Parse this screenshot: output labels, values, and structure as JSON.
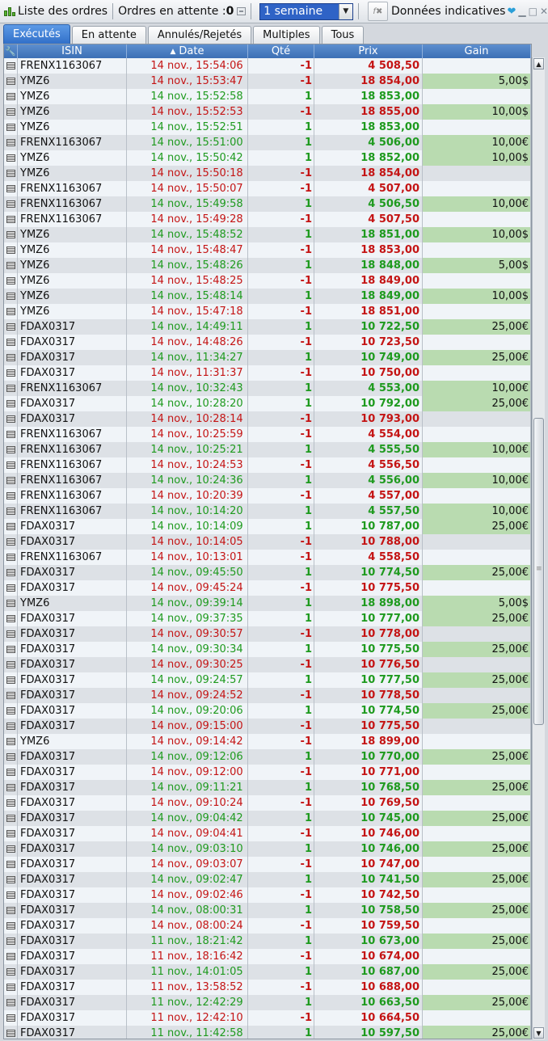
{
  "toolbar": {
    "title": "Liste des ordres",
    "pending_label": "Ordres en attente :",
    "pending_count": "0",
    "period_value": "1 semaine",
    "filter_icon": "f",
    "indicative_label": "Données indicatives"
  },
  "tabs": [
    "Exécutés",
    "En attente",
    "Annulés/Rejetés",
    "Multiples",
    "Tous"
  ],
  "columns": {
    "isin": "ISIN",
    "date": "Date",
    "qty": "Qté",
    "prix": "Prix",
    "gain": "Gain"
  },
  "colors": {
    "buy": "#1e9a1e",
    "sell": "#c41414",
    "gain_bg": "#b9dbb0",
    "header": "#3c6fb5"
  },
  "rows": [
    {
      "isin": "FRENX1163067",
      "date": "14 nov., 15:54:06",
      "qty": "-1",
      "prix": "4 508,50",
      "gain": ""
    },
    {
      "isin": "YMZ6",
      "date": "14 nov., 15:53:47",
      "qty": "-1",
      "prix": "18 854,00",
      "gain": "5,00$"
    },
    {
      "isin": "YMZ6",
      "date": "14 nov., 15:52:58",
      "qty": "1",
      "prix": "18 853,00",
      "gain": ""
    },
    {
      "isin": "YMZ6",
      "date": "14 nov., 15:52:53",
      "qty": "-1",
      "prix": "18 855,00",
      "gain": "10,00$"
    },
    {
      "isin": "YMZ6",
      "date": "14 nov., 15:52:51",
      "qty": "1",
      "prix": "18 853,00",
      "gain": ""
    },
    {
      "isin": "FRENX1163067",
      "date": "14 nov., 15:51:00",
      "qty": "1",
      "prix": "4 506,00",
      "gain": "10,00€"
    },
    {
      "isin": "YMZ6",
      "date": "14 nov., 15:50:42",
      "qty": "1",
      "prix": "18 852,00",
      "gain": "10,00$"
    },
    {
      "isin": "YMZ6",
      "date": "14 nov., 15:50:18",
      "qty": "-1",
      "prix": "18 854,00",
      "gain": ""
    },
    {
      "isin": "FRENX1163067",
      "date": "14 nov., 15:50:07",
      "qty": "-1",
      "prix": "4 507,00",
      "gain": ""
    },
    {
      "isin": "FRENX1163067",
      "date": "14 nov., 15:49:58",
      "qty": "1",
      "prix": "4 506,50",
      "gain": "10,00€"
    },
    {
      "isin": "FRENX1163067",
      "date": "14 nov., 15:49:28",
      "qty": "-1",
      "prix": "4 507,50",
      "gain": ""
    },
    {
      "isin": "YMZ6",
      "date": "14 nov., 15:48:52",
      "qty": "1",
      "prix": "18 851,00",
      "gain": "10,00$"
    },
    {
      "isin": "YMZ6",
      "date": "14 nov., 15:48:47",
      "qty": "-1",
      "prix": "18 853,00",
      "gain": ""
    },
    {
      "isin": "YMZ6",
      "date": "14 nov., 15:48:26",
      "qty": "1",
      "prix": "18 848,00",
      "gain": "5,00$"
    },
    {
      "isin": "YMZ6",
      "date": "14 nov., 15:48:25",
      "qty": "-1",
      "prix": "18 849,00",
      "gain": ""
    },
    {
      "isin": "YMZ6",
      "date": "14 nov., 15:48:14",
      "qty": "1",
      "prix": "18 849,00",
      "gain": "10,00$"
    },
    {
      "isin": "YMZ6",
      "date": "14 nov., 15:47:18",
      "qty": "-1",
      "prix": "18 851,00",
      "gain": ""
    },
    {
      "isin": "FDAX0317",
      "date": "14 nov., 14:49:11",
      "qty": "1",
      "prix": "10 722,50",
      "gain": "25,00€"
    },
    {
      "isin": "FDAX0317",
      "date": "14 nov., 14:48:26",
      "qty": "-1",
      "prix": "10 723,50",
      "gain": ""
    },
    {
      "isin": "FDAX0317",
      "date": "14 nov., 11:34:27",
      "qty": "1",
      "prix": "10 749,00",
      "gain": "25,00€"
    },
    {
      "isin": "FDAX0317",
      "date": "14 nov., 11:31:37",
      "qty": "-1",
      "prix": "10 750,00",
      "gain": ""
    },
    {
      "isin": "FRENX1163067",
      "date": "14 nov., 10:32:43",
      "qty": "1",
      "prix": "4 553,00",
      "gain": "10,00€"
    },
    {
      "isin": "FDAX0317",
      "date": "14 nov., 10:28:20",
      "qty": "1",
      "prix": "10 792,00",
      "gain": "25,00€"
    },
    {
      "isin": "FDAX0317",
      "date": "14 nov., 10:28:14",
      "qty": "-1",
      "prix": "10 793,00",
      "gain": ""
    },
    {
      "isin": "FRENX1163067",
      "date": "14 nov., 10:25:59",
      "qty": "-1",
      "prix": "4 554,00",
      "gain": ""
    },
    {
      "isin": "FRENX1163067",
      "date": "14 nov., 10:25:21",
      "qty": "1",
      "prix": "4 555,50",
      "gain": "10,00€"
    },
    {
      "isin": "FRENX1163067",
      "date": "14 nov., 10:24:53",
      "qty": "-1",
      "prix": "4 556,50",
      "gain": ""
    },
    {
      "isin": "FRENX1163067",
      "date": "14 nov., 10:24:36",
      "qty": "1",
      "prix": "4 556,00",
      "gain": "10,00€"
    },
    {
      "isin": "FRENX1163067",
      "date": "14 nov., 10:20:39",
      "qty": "-1",
      "prix": "4 557,00",
      "gain": ""
    },
    {
      "isin": "FRENX1163067",
      "date": "14 nov., 10:14:20",
      "qty": "1",
      "prix": "4 557,50",
      "gain": "10,00€"
    },
    {
      "isin": "FDAX0317",
      "date": "14 nov., 10:14:09",
      "qty": "1",
      "prix": "10 787,00",
      "gain": "25,00€"
    },
    {
      "isin": "FDAX0317",
      "date": "14 nov., 10:14:05",
      "qty": "-1",
      "prix": "10 788,00",
      "gain": ""
    },
    {
      "isin": "FRENX1163067",
      "date": "14 nov., 10:13:01",
      "qty": "-1",
      "prix": "4 558,50",
      "gain": ""
    },
    {
      "isin": "FDAX0317",
      "date": "14 nov., 09:45:50",
      "qty": "1",
      "prix": "10 774,50",
      "gain": "25,00€"
    },
    {
      "isin": "FDAX0317",
      "date": "14 nov., 09:45:24",
      "qty": "-1",
      "prix": "10 775,50",
      "gain": ""
    },
    {
      "isin": "YMZ6",
      "date": "14 nov., 09:39:14",
      "qty": "1",
      "prix": "18 898,00",
      "gain": "5,00$"
    },
    {
      "isin": "FDAX0317",
      "date": "14 nov., 09:37:35",
      "qty": "1",
      "prix": "10 777,00",
      "gain": "25,00€"
    },
    {
      "isin": "FDAX0317",
      "date": "14 nov., 09:30:57",
      "qty": "-1",
      "prix": "10 778,00",
      "gain": ""
    },
    {
      "isin": "FDAX0317",
      "date": "14 nov., 09:30:34",
      "qty": "1",
      "prix": "10 775,50",
      "gain": "25,00€"
    },
    {
      "isin": "FDAX0317",
      "date": "14 nov., 09:30:25",
      "qty": "-1",
      "prix": "10 776,50",
      "gain": ""
    },
    {
      "isin": "FDAX0317",
      "date": "14 nov., 09:24:57",
      "qty": "1",
      "prix": "10 777,50",
      "gain": "25,00€"
    },
    {
      "isin": "FDAX0317",
      "date": "14 nov., 09:24:52",
      "qty": "-1",
      "prix": "10 778,50",
      "gain": ""
    },
    {
      "isin": "FDAX0317",
      "date": "14 nov., 09:20:06",
      "qty": "1",
      "prix": "10 774,50",
      "gain": "25,00€"
    },
    {
      "isin": "FDAX0317",
      "date": "14 nov., 09:15:00",
      "qty": "-1",
      "prix": "10 775,50",
      "gain": ""
    },
    {
      "isin": "YMZ6",
      "date": "14 nov., 09:14:42",
      "qty": "-1",
      "prix": "18 899,00",
      "gain": ""
    },
    {
      "isin": "FDAX0317",
      "date": "14 nov., 09:12:06",
      "qty": "1",
      "prix": "10 770,00",
      "gain": "25,00€"
    },
    {
      "isin": "FDAX0317",
      "date": "14 nov., 09:12:00",
      "qty": "-1",
      "prix": "10 771,00",
      "gain": ""
    },
    {
      "isin": "FDAX0317",
      "date": "14 nov., 09:11:21",
      "qty": "1",
      "prix": "10 768,50",
      "gain": "25,00€"
    },
    {
      "isin": "FDAX0317",
      "date": "14 nov., 09:10:24",
      "qty": "-1",
      "prix": "10 769,50",
      "gain": ""
    },
    {
      "isin": "FDAX0317",
      "date": "14 nov., 09:04:42",
      "qty": "1",
      "prix": "10 745,00",
      "gain": "25,00€"
    },
    {
      "isin": "FDAX0317",
      "date": "14 nov., 09:04:41",
      "qty": "-1",
      "prix": "10 746,00",
      "gain": ""
    },
    {
      "isin": "FDAX0317",
      "date": "14 nov., 09:03:10",
      "qty": "1",
      "prix": "10 746,00",
      "gain": "25,00€"
    },
    {
      "isin": "FDAX0317",
      "date": "14 nov., 09:03:07",
      "qty": "-1",
      "prix": "10 747,00",
      "gain": ""
    },
    {
      "isin": "FDAX0317",
      "date": "14 nov., 09:02:47",
      "qty": "1",
      "prix": "10 741,50",
      "gain": "25,00€"
    },
    {
      "isin": "FDAX0317",
      "date": "14 nov., 09:02:46",
      "qty": "-1",
      "prix": "10 742,50",
      "gain": ""
    },
    {
      "isin": "FDAX0317",
      "date": "14 nov., 08:00:31",
      "qty": "1",
      "prix": "10 758,50",
      "gain": "25,00€"
    },
    {
      "isin": "FDAX0317",
      "date": "14 nov., 08:00:24",
      "qty": "-1",
      "prix": "10 759,50",
      "gain": ""
    },
    {
      "isin": "FDAX0317",
      "date": "11 nov., 18:21:42",
      "qty": "1",
      "prix": "10 673,00",
      "gain": "25,00€"
    },
    {
      "isin": "FDAX0317",
      "date": "11 nov., 18:16:42",
      "qty": "-1",
      "prix": "10 674,00",
      "gain": ""
    },
    {
      "isin": "FDAX0317",
      "date": "11 nov., 14:01:05",
      "qty": "1",
      "prix": "10 687,00",
      "gain": "25,00€"
    },
    {
      "isin": "FDAX0317",
      "date": "11 nov., 13:58:52",
      "qty": "-1",
      "prix": "10 688,00",
      "gain": ""
    },
    {
      "isin": "FDAX0317",
      "date": "11 nov., 12:42:29",
      "qty": "1",
      "prix": "10 663,50",
      "gain": "25,00€"
    },
    {
      "isin": "FDAX0317",
      "date": "11 nov., 12:42:10",
      "qty": "-1",
      "prix": "10 664,50",
      "gain": ""
    },
    {
      "isin": "FDAX0317",
      "date": "11 nov., 11:42:58",
      "qty": "1",
      "prix": "10 597,50",
      "gain": "25,00€"
    }
  ]
}
